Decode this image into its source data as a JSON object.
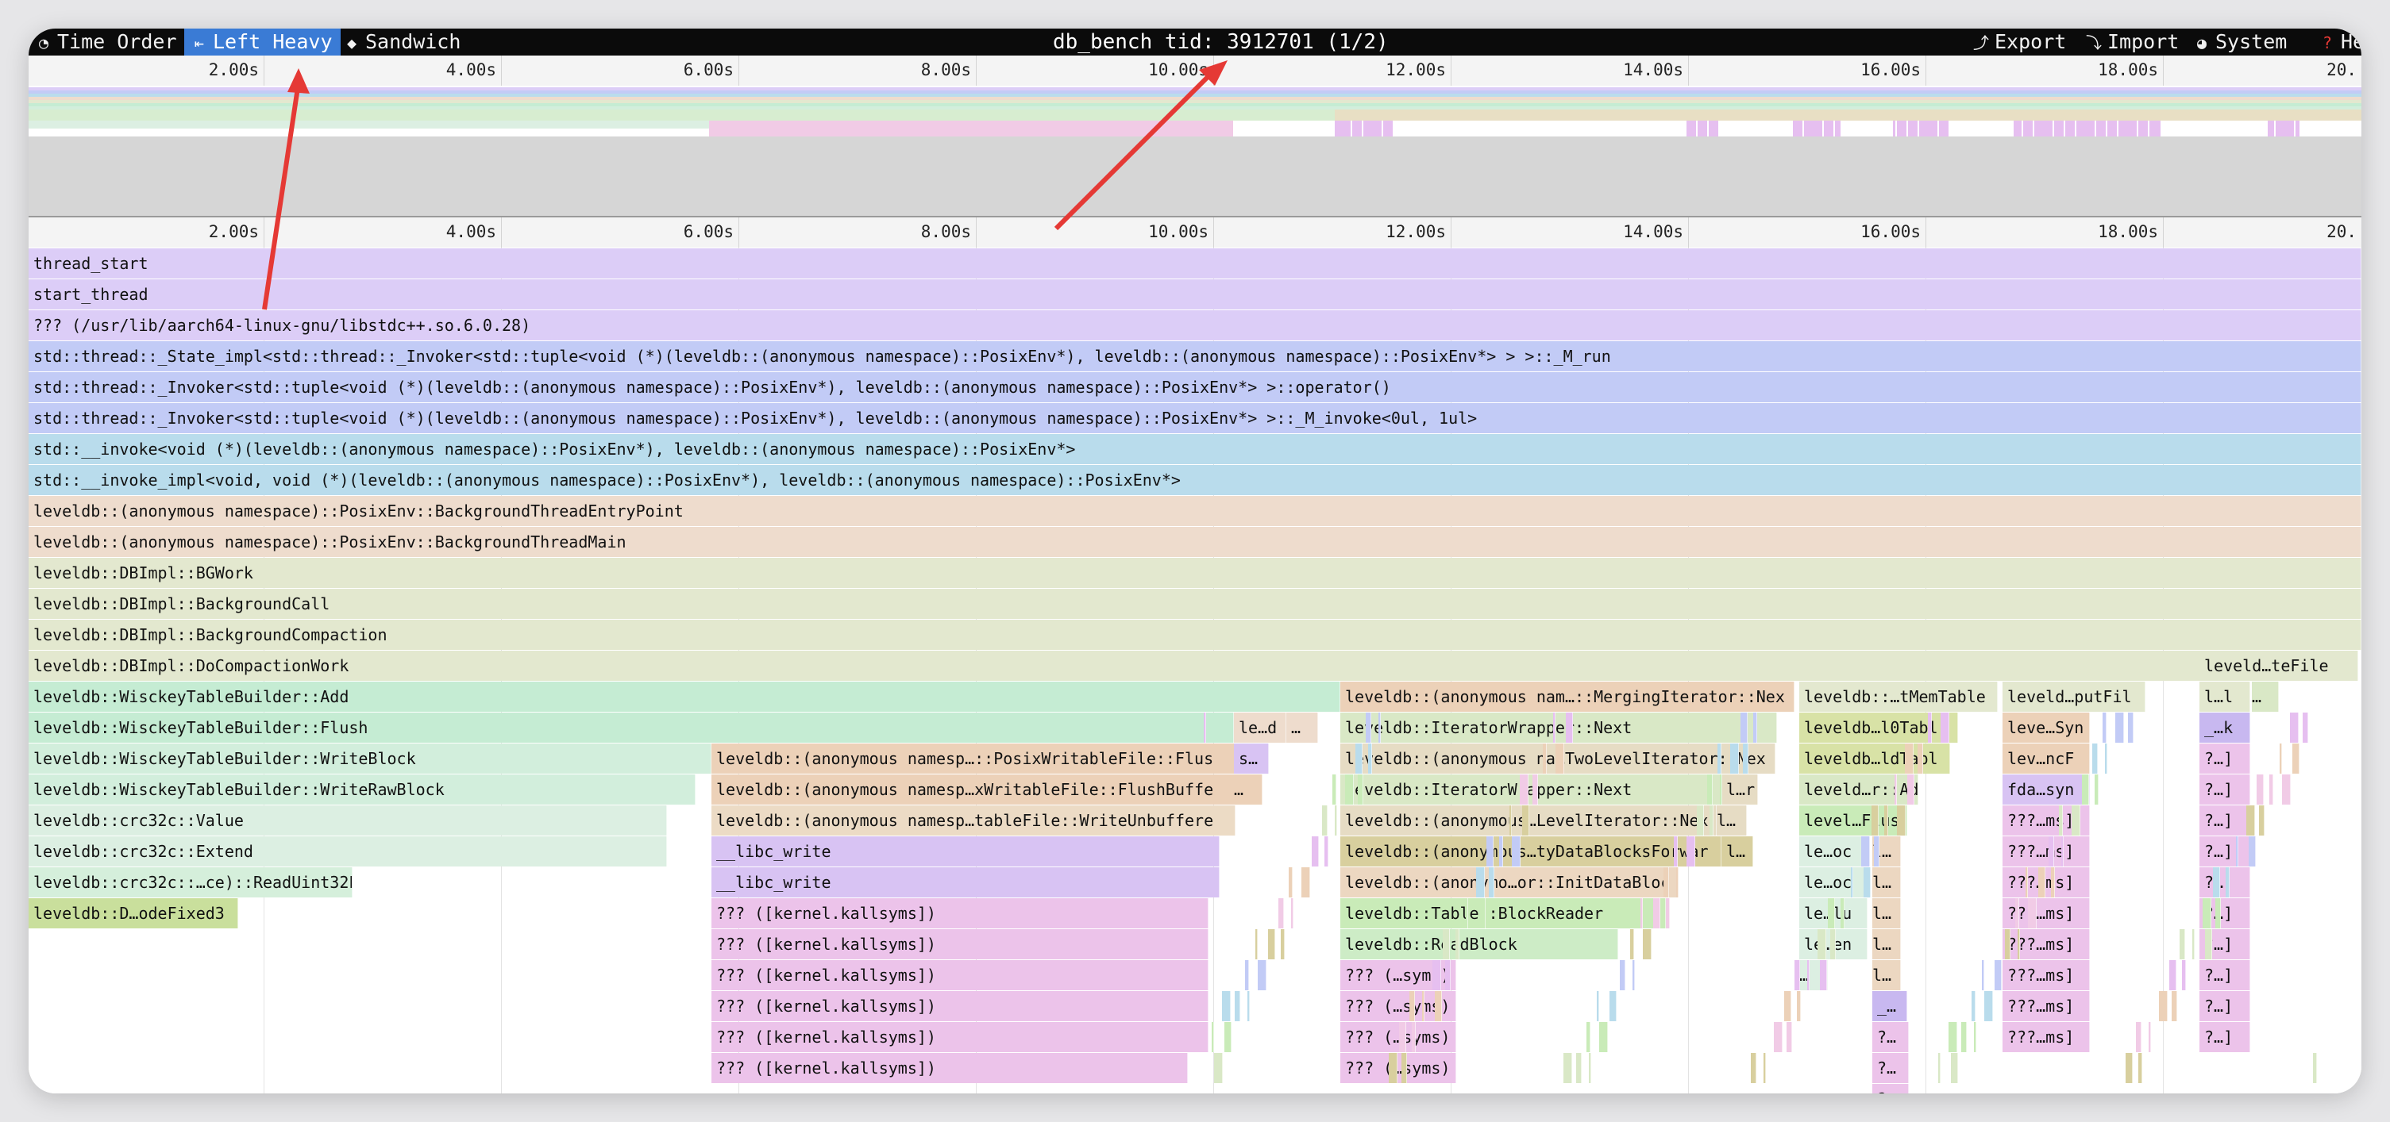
{
  "toolbar": {
    "time_order": "Time Order",
    "left_heavy": "Left Heavy",
    "sandwich": "Sandwich",
    "title": "db_bench tid: 3912701 (1/2)",
    "export": "Export",
    "import": "Import",
    "system": "System",
    "help": "Help",
    "icons": [
      "clock-icon",
      "left-heavy-icon",
      "sandwich-icon",
      "export-icon",
      "import-icon",
      "palette-icon",
      "help-icon"
    ]
  },
  "ruler_ticks": [
    "2.00s",
    "4.00s",
    "6.00s",
    "8.00s",
    "10.00s",
    "12.00s",
    "14.00s",
    "16.00s",
    "18.00s",
    "20."
  ],
  "frames": [
    [
      "thread_start",
      "#dccdf7"
    ],
    [
      "start_thread",
      "#dccdf7"
    ],
    [
      "??? (/usr/lib/aarch64-linux-gnu/libstdc++.so.6.0.28)",
      "#dccdf7"
    ],
    [
      "std::thread::_State_impl<std::thread::_Invoker<std::tuple<void (*)(leveldb::(anonymous namespace)::PosixEnv*), leveldb::(anonymous namespace)::PosixEnv*> > >::_M_run",
      "#c2cbf6"
    ],
    [
      "std::thread::_Invoker<std::tuple<void (*)(leveldb::(anonymous namespace)::PosixEnv*), leveldb::(anonymous namespace)::PosixEnv*> >::operator()",
      "#c2cbf6"
    ],
    [
      "std::thread::_Invoker<std::tuple<void (*)(leveldb::(anonymous namespace)::PosixEnv*), leveldb::(anonymous namespace)::PosixEnv*> >::_M_invoke<0ul, 1ul>",
      "#c2cbf6"
    ],
    [
      "std::__invoke<void (*)(leveldb::(anonymous namespace)::PosixEnv*), leveldb::(anonymous namespace)::PosixEnv*>",
      "#b9dcec"
    ],
    [
      "std::__invoke_impl<void, void (*)(leveldb::(anonymous namespace)::PosixEnv*), leveldb::(anonymous namespace)::PosixEnv*>",
      "#b9dcec"
    ],
    [
      "leveldb::(anonymous namespace)::PosixEnv::BackgroundThreadEntryPoint",
      "#eedccd"
    ],
    [
      "leveldb::(anonymous namespace)::PosixEnv::BackgroundThreadMain",
      "#eedccd"
    ],
    [
      "leveldb::DBImpl::BGWork",
      "#e3e8cf"
    ],
    [
      "leveldb::DBImpl::BackgroundCall",
      "#e3e8cf"
    ],
    [
      "leveldb::DBImpl::BackgroundCompaction",
      "#e3e8cf"
    ],
    [
      "leveldb::DBImpl::DoCompactionWork",
      "#e3e8cf"
    ],
    [
      "leveldb::WisckeyTableBuilder::Add",
      "#c5ecd3"
    ],
    [
      "leveldb::WisckeyTableBuilder::Flush",
      "#c5ecd3"
    ],
    [
      "leveldb::WisckeyTableBuilder::WriteBlock",
      "#d2eedc"
    ],
    [
      "leveldb::WisckeyTableBuilder::WriteRawBlock",
      "#d2eedc"
    ],
    [
      "leveldb::crc32c::Value",
      "#dcefe2"
    ],
    [
      "leveldb::crc32c::Extend",
      "#dcefe2"
    ],
    [
      "leveldb::crc32c::…ce)::ReadUint32L",
      "#d5efdb"
    ],
    [
      "leveldb::D…odeFixed3",
      "#c9df9c"
    ],
    [
      "leveldb::(anonymous namesp…::PosixWritableFile::Flus",
      "#ecd1b8"
    ],
    [
      "leveldb::(anonymous namesp…xWritableFile::FlushBuffe",
      "#ecd1b8"
    ],
    [
      "leveldb::(anonymous namesp…tableFile::WriteUnbuffere",
      "#ecdbc5"
    ],
    [
      "__libc_write",
      "#d8c3f3"
    ],
    [
      "__libc_write",
      "#d8c3f3"
    ],
    [
      "??? ([kernel.kallsyms])",
      "#ecc3ea"
    ],
    [
      "??? ([kernel.kallsyms])",
      "#ecc3ea"
    ],
    [
      "??? ([kernel.kallsyms])",
      "#ecc3ea"
    ],
    [
      "??? ([kernel.kallsyms])",
      "#ecc3ea"
    ],
    [
      "??? ([kernel.kallsyms])",
      "#ecc3ea"
    ],
    [
      "??? ([kernel.kallsyms])",
      "#ecc3ea"
    ],
    [
      "le…d",
      "#eedccd"
    ],
    [
      "…",
      "#eedccd"
    ],
    [
      "s…",
      "#d8c3f3"
    ],
    [
      "…",
      "#ecd1b8"
    ],
    [
      "leveldb::(anonymous nam…::MergingIterator::Nex",
      "#ecd1b8"
    ],
    [
      "leveldb::IteratorWrapper::Next",
      "#d9e8c6"
    ],
    [
      "leveldb::(anonymous na…TwoLevelIterator::Nex",
      "#e6dcc4"
    ],
    [
      "leveldb::IteratorWrapper::Next",
      "#d9e8c6"
    ],
    [
      "l…r",
      "#e6dcc4"
    ],
    [
      "leveldb::(anonymous…LevelIterator::Nex",
      "#e6dcc4"
    ],
    [
      "l…",
      "#e6dcc4"
    ],
    [
      "leveldb::(anonymous…tyDataBlocksForwar",
      "#d8cf9e"
    ],
    [
      "l…",
      "#d8cf9e"
    ],
    [
      "leveldb::(anonymo…or::InitDataBloc",
      "#ecd7c1"
    ],
    [
      "leveldb::Table::BlockReader",
      "#c9ebb8"
    ],
    [
      "leveldb::ReadBlock",
      "#cdecc6"
    ],
    [
      "??? (…syms)",
      "#ecc3ea"
    ],
    [
      "??? (…syms)",
      "#ecc3ea"
    ],
    [
      "??? (…syms)",
      "#ecc3ea"
    ],
    [
      "??? (…syms)",
      "#ecc3ea"
    ],
    [
      "leveldb::…tMemTable",
      "#e3e8cf"
    ],
    [
      "leveldb…l0Tabl",
      "#d8e2a6"
    ],
    [
      "leveldb…ldTabl",
      "#d8e2a6"
    ],
    [
      "leveld…r::Ad",
      "#d9e8c6"
    ],
    [
      "level…Flus",
      "#c9ebb8"
    ],
    [
      "le…oc",
      "#dcefe2"
    ],
    [
      "le…oc",
      "#dcefe2"
    ],
    [
      "le…lu",
      "#dcefe2"
    ],
    [
      "le…en",
      "#dcefe2"
    ],
    [
      "…",
      "#dcefe2"
    ],
    [
      "l…",
      "#ecd7c1"
    ],
    [
      "l…",
      "#ecd7c1"
    ],
    [
      "l…",
      "#ecd7c1"
    ],
    [
      "l…",
      "#ecd7c1"
    ],
    [
      "l…",
      "#ecd7c1"
    ],
    [
      "_…",
      "#c8b8f0"
    ],
    [
      "?…",
      "#ecc3ea"
    ],
    [
      "?…",
      "#ecc3ea"
    ],
    [
      "?…",
      "#ecc3ea"
    ],
    [
      "?…",
      "#ecc3ea"
    ],
    [
      "leveld…putFil",
      "#e3e8cf"
    ],
    [
      "leve…Syn",
      "#ecd1b8"
    ],
    [
      "lev…ncF",
      "#ecd1b8"
    ],
    [
      "fda…syn",
      "#d8c3f3"
    ],
    [
      "???…ms]",
      "#ecc3ea"
    ],
    [
      "???…ms]",
      "#ecc3ea"
    ],
    [
      "???…ms]",
      "#ecc3ea"
    ],
    [
      "???…ms]",
      "#ecc3ea"
    ],
    [
      "???…ms]",
      "#ecc3ea"
    ],
    [
      "???…ms]",
      "#ecc3ea"
    ],
    [
      "???…ms]",
      "#ecc3ea"
    ],
    [
      "???…ms]",
      "#ecc3ea"
    ],
    [
      "leveld…teFile",
      "#e3e8cf"
    ],
    [
      "l…l",
      "#e3e8cf"
    ],
    [
      "…",
      "#d9e8c6"
    ],
    [
      "_…k",
      "#c8b8f0"
    ],
    [
      "?…]",
      "#ecc3ea"
    ],
    [
      "?…]",
      "#ecc3ea"
    ],
    [
      "?…]",
      "#ecc3ea"
    ],
    [
      "?…]",
      "#ecc3ea"
    ],
    [
      "?…]",
      "#ecc3ea"
    ],
    [
      "?…]",
      "#ecc3ea"
    ],
    [
      "?…]",
      "#ecc3ea"
    ],
    [
      "?…]",
      "#ecc3ea"
    ],
    [
      "?…]",
      "#ecc3ea"
    ],
    [
      "?…]",
      "#ecc3ea"
    ]
  ],
  "colors": {
    "annotation_arrow": "#e53935",
    "active_tab": "#3a7bd5"
  }
}
